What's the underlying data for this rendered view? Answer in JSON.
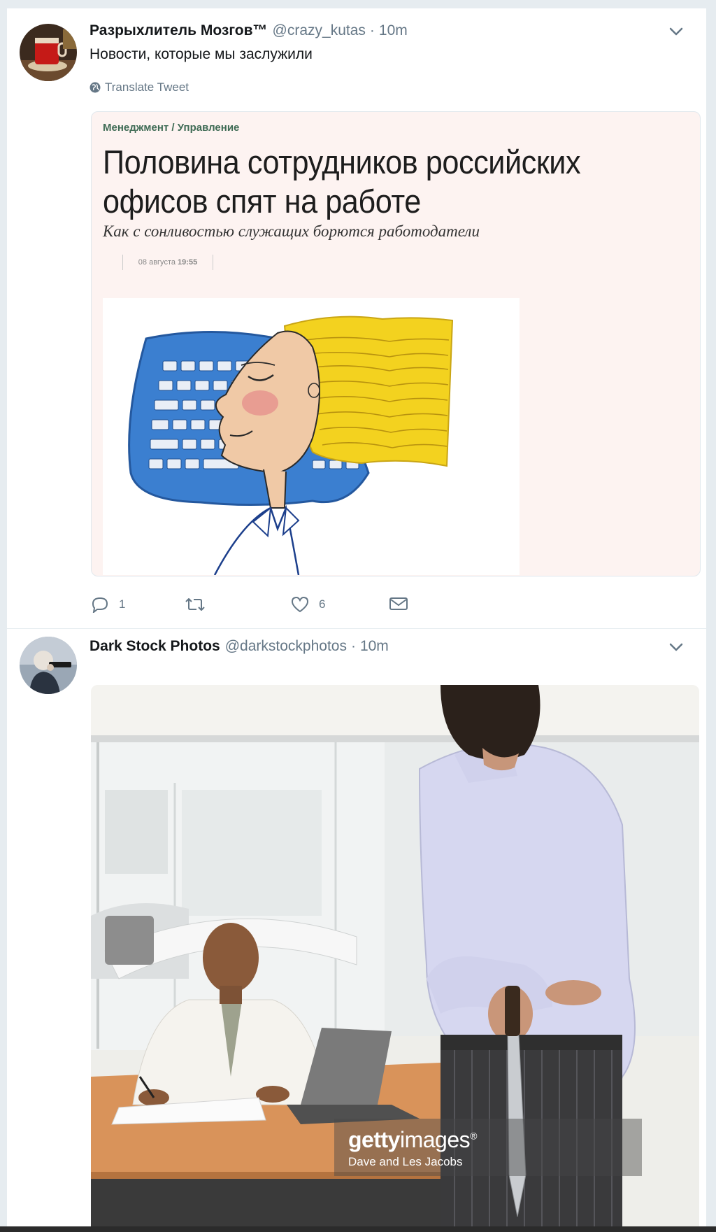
{
  "tweets": [
    {
      "display_name": "Разрыхлитель Мозгов™",
      "handle": "@crazy_kutas",
      "separator": "·",
      "time": "10m",
      "text": "Новости, которые мы заслужили",
      "translate_label": "Translate Tweet",
      "card": {
        "rubric": "Менеджмент / Управление",
        "headline": "Половина сотрудников российских офисов спят на работе",
        "subtitle": "Как с сонливостью служащих борются работодатели",
        "date": "08 августа",
        "time": "19:55"
      },
      "actions": {
        "replies": "1",
        "likes": "6"
      }
    },
    {
      "display_name": "Dark Stock Photos",
      "handle": "@darkstockphotos",
      "separator": "·",
      "time": "10m",
      "photo": {
        "watermark_brand_bold": "getty",
        "watermark_brand": "images",
        "watermark_reg": "®",
        "watermark_credit": "Dave and Les Jacobs"
      }
    }
  ],
  "icons": {
    "caret": "chevron-down-icon",
    "globe": "globe-icon",
    "reply": "reply-icon",
    "retweet": "retweet-icon",
    "like": "heart-icon",
    "dm": "envelope-icon"
  },
  "colors": {
    "secondary_text": "#657786",
    "card_background": "#fdf3f1",
    "rubric": "#3f6b55"
  }
}
